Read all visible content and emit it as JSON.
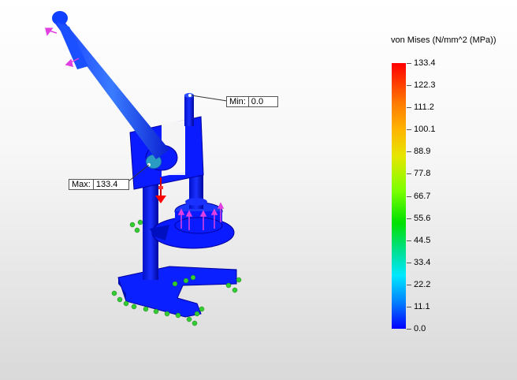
{
  "legend": {
    "title": "von Mises (N/mm^2 (MPa))",
    "values": [
      "133.4",
      "122.3",
      "111.2",
      "100.1",
      "88.9",
      "77.8",
      "66.7",
      "55.6",
      "44.5",
      "33.4",
      "22.2",
      "11.1",
      "0.0"
    ]
  },
  "probes": {
    "min": {
      "label": "Min:",
      "value": "0.0"
    },
    "max": {
      "label": "Max:",
      "value": "133.4"
    }
  },
  "colors": {
    "model": "#0a1cff",
    "model_dark": "#0000a8",
    "fixture": "#33cc33",
    "load_arrow": "#e040e0",
    "gravity_arrow": "#ff0000"
  }
}
